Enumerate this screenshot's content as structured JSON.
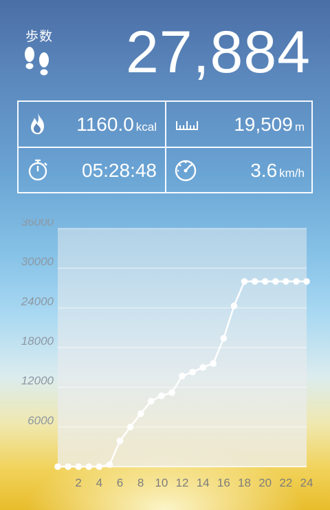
{
  "header": {
    "steps_label": "歩数",
    "steps_value": "27,884"
  },
  "stats": {
    "calories": {
      "value": "1160.0",
      "unit": "kcal",
      "icon": "flame-icon"
    },
    "distance": {
      "value": "19,509",
      "unit": "m",
      "icon": "ruler-icon"
    },
    "duration": {
      "value": "05:28:48",
      "icon": "stopwatch-icon"
    },
    "speed": {
      "value": "3.6",
      "unit": "km/h",
      "icon": "speedometer-icon"
    }
  },
  "colors": {
    "text": "#ffffff",
    "axis_label": "#8d98a3",
    "tick_label": "#7d7d7d"
  },
  "chart_data": {
    "type": "line",
    "x": [
      0,
      1,
      2,
      3,
      4,
      5,
      6,
      7,
      8,
      9,
      10,
      11,
      12,
      13,
      14,
      15,
      16,
      17,
      18,
      19,
      20,
      21,
      22,
      23,
      24
    ],
    "series": [
      {
        "values": [
          0,
          0,
          0,
          0,
          0,
          300,
          3900,
          6000,
          8000,
          9900,
          10700,
          11200,
          13700,
          14300,
          15000,
          15600,
          19400,
          24300,
          28000,
          28000,
          28000,
          28000,
          28000,
          28000,
          28000
        ]
      }
    ],
    "xticks": [
      2,
      4,
      6,
      8,
      10,
      12,
      14,
      16,
      18,
      20,
      22,
      24
    ],
    "xtick_labels": [
      "2",
      "4",
      "6",
      "8",
      "10",
      "12",
      "14",
      "16",
      "18",
      "20",
      "22",
      "24"
    ],
    "yticks": [
      6000,
      12000,
      18000,
      24000,
      30000,
      36000
    ],
    "ytick_labels": [
      "6000",
      "12000",
      "18000",
      "24000",
      "30000",
      "36000"
    ],
    "xlim": [
      0,
      24
    ],
    "ylim": [
      0,
      36000
    ],
    "grid": true
  }
}
